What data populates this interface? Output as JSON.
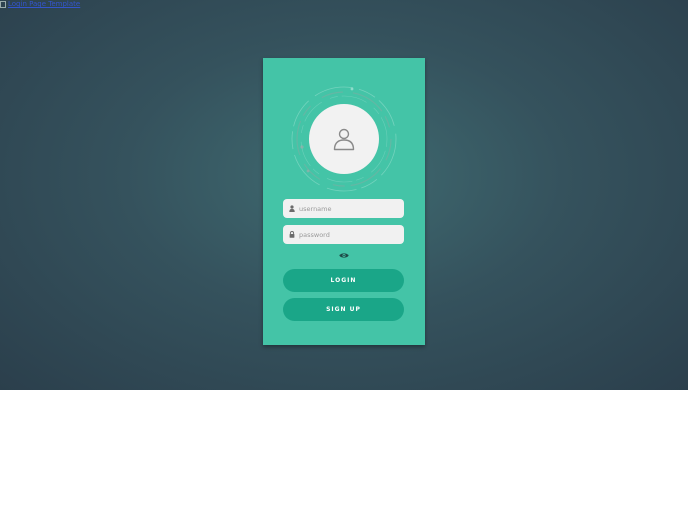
{
  "broken_image": {
    "alt_text": "Login Page Template"
  },
  "login_form": {
    "username": {
      "placeholder": "username",
      "icon": "user-icon"
    },
    "password": {
      "placeholder": "password",
      "icon": "lock-icon"
    },
    "show_password_icon": "eye-icon",
    "avatar_icon": "user-outline-icon",
    "login_label": "LOGIN",
    "signup_label": "SIGN UP"
  },
  "colors": {
    "background_center": "#3f6b71",
    "background_edge": "#2b3f4c",
    "card": "#44c4a7",
    "button": "#1aa688",
    "field": "#f1f1f1",
    "avatar": "#f2f2f2"
  }
}
